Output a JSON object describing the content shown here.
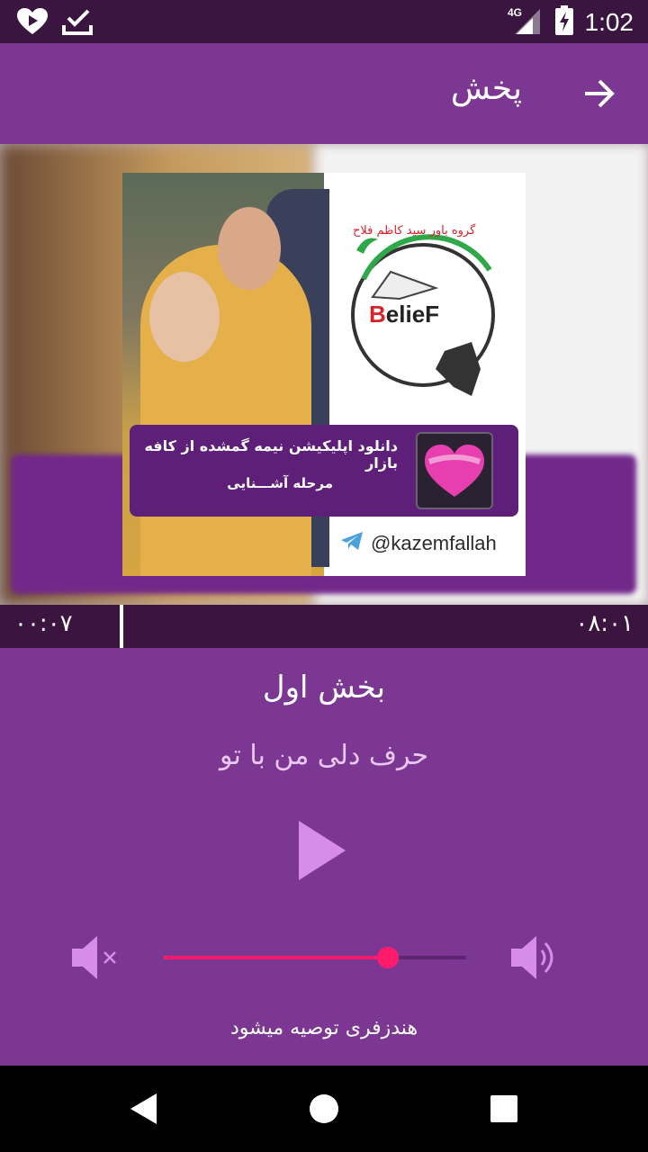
{
  "status_bar": {
    "time": "1:02",
    "network": "4G",
    "icons": [
      "heart-icon",
      "download-check-icon",
      "signal-icon",
      "battery-charging-icon"
    ]
  },
  "app_bar": {
    "title": "پخش",
    "back_icon": "arrow-right-icon"
  },
  "cover": {
    "logo_text": "BelieF",
    "logo_arc_text": "گروه باور سید کاظم فلاح",
    "promo_line1": "دانلود اپلیکیشن نیمه گمشده از کافه بازار",
    "promo_line2": "مرحله آشـــنایی",
    "telegram_handle": "@kazemfallah"
  },
  "progress": {
    "elapsed": "۰۰:۰۷",
    "total": "۰۸:۰۱",
    "fraction": 0.015
  },
  "player": {
    "part_title": "بخش اول",
    "track_title": "حرف دلی من با تو",
    "volume": 0.74,
    "hint": "هندزفری توصیه میشود"
  },
  "colors": {
    "primary": "#7b3791",
    "dark": "#3b1540",
    "accent": "#ff1b6b",
    "play": "#d68ce8"
  }
}
